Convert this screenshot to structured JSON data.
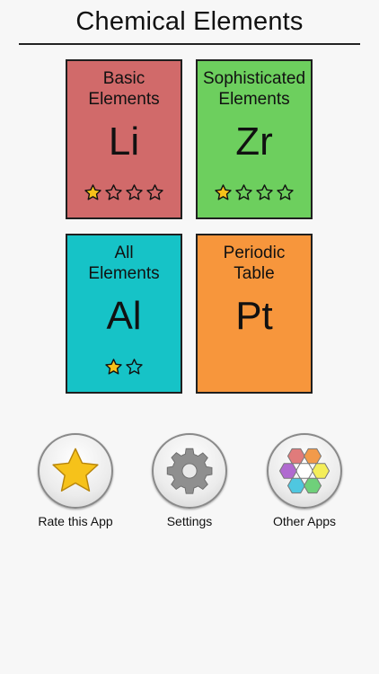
{
  "header": {
    "title": "Chemical Elements"
  },
  "cards": [
    {
      "name": "Basic\nElements",
      "symbol": "Li",
      "color": "#d16a6a",
      "stars_total": 4,
      "stars_filled": 1
    },
    {
      "name": "Sophisticated\nElements",
      "symbol": "Zr",
      "color": "#6dcf5e",
      "stars_total": 4,
      "stars_filled": 1
    },
    {
      "name": "All\nElements",
      "symbol": "Al",
      "color": "#16c3c7",
      "stars_total": 2,
      "stars_filled": 1
    },
    {
      "name": "Periodic\nTable",
      "symbol": "Pt",
      "color": "#f7963c",
      "stars_total": 0,
      "stars_filled": 0
    }
  ],
  "actions": {
    "rate_label": "Rate this App",
    "settings_label": "Settings",
    "other_apps_label": "Other Apps"
  },
  "icons": {
    "rate": "star-icon",
    "settings": "gear-icon",
    "other_apps": "hexagons-icon"
  },
  "colors": {
    "star_gold": "#f6c21a",
    "hex_colors": [
      "#e07b7b",
      "#f29a4a",
      "#b06ad0",
      "#f4ee5a",
      "#4fc7e0",
      "#6fd07a"
    ]
  }
}
